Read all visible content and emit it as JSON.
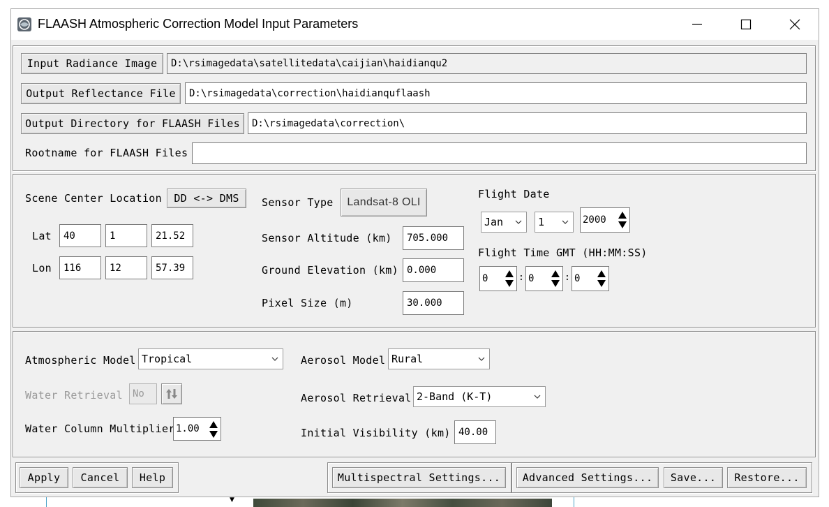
{
  "window": {
    "title": "FLAASH Atmospheric Correction Model Input Parameters"
  },
  "files": {
    "input_radiance_label": "Input Radiance Image",
    "input_radiance_value": "D:\\rsimagedata\\satellitedata\\caijian\\haidianqu2",
    "output_reflectance_label": "Output Reflectance File",
    "output_reflectance_value": "D:\\rsimagedata\\correction\\haidianquflaash",
    "output_directory_label": "Output Directory for FLAASH Files",
    "output_directory_value": "D:\\rsimagedata\\correction\\",
    "rootname_label": "Rootname for FLAASH Files",
    "rootname_value": ""
  },
  "scene": {
    "center_label": "Scene Center Location",
    "dd_dms_label": "DD <-> DMS",
    "lat_label": "Lat",
    "lat": [
      "40",
      "1",
      "21.52"
    ],
    "lon_label": "Lon",
    "lon": [
      "116",
      "12",
      "57.39"
    ],
    "sensor_type_label": "Sensor Type",
    "sensor_type_value": "Landsat-8 OLI",
    "sensor_altitude_label": "Sensor Altitude (km)",
    "sensor_altitude_value": "705.000",
    "ground_elevation_label": "Ground Elevation (km)",
    "ground_elevation_value": "0.000",
    "pixel_size_label": "Pixel Size (m)",
    "pixel_size_value": "30.000",
    "flight_date_label": "Flight Date",
    "month": "Jan",
    "day": "1",
    "year": "2000",
    "flight_time_label": "Flight Time GMT (HH:MM:SS)",
    "time": [
      "0",
      "0",
      "0"
    ],
    "time_sep": ":"
  },
  "model": {
    "atmospheric_model_label": "Atmospheric Model",
    "atmospheric_model_value": "Tropical",
    "water_retrieval_label": "Water Retrieval",
    "water_retrieval_value": "No",
    "water_column_label": "Water Column Multiplier",
    "water_column_value": "1.00",
    "aerosol_model_label": "Aerosol Model",
    "aerosol_model_value": "Rural",
    "aerosol_retrieval_label": "Aerosol Retrieval",
    "aerosol_retrieval_value": "2-Band (K-T)",
    "initial_visibility_label": "Initial Visibility (km)",
    "initial_visibility_value": "40.00"
  },
  "actions": {
    "apply": "Apply",
    "cancel": "Cancel",
    "help": "Help",
    "multispectral": "Multispectral Settings...",
    "advanced": "Advanced Settings...",
    "save": "Save...",
    "restore": "Restore..."
  }
}
